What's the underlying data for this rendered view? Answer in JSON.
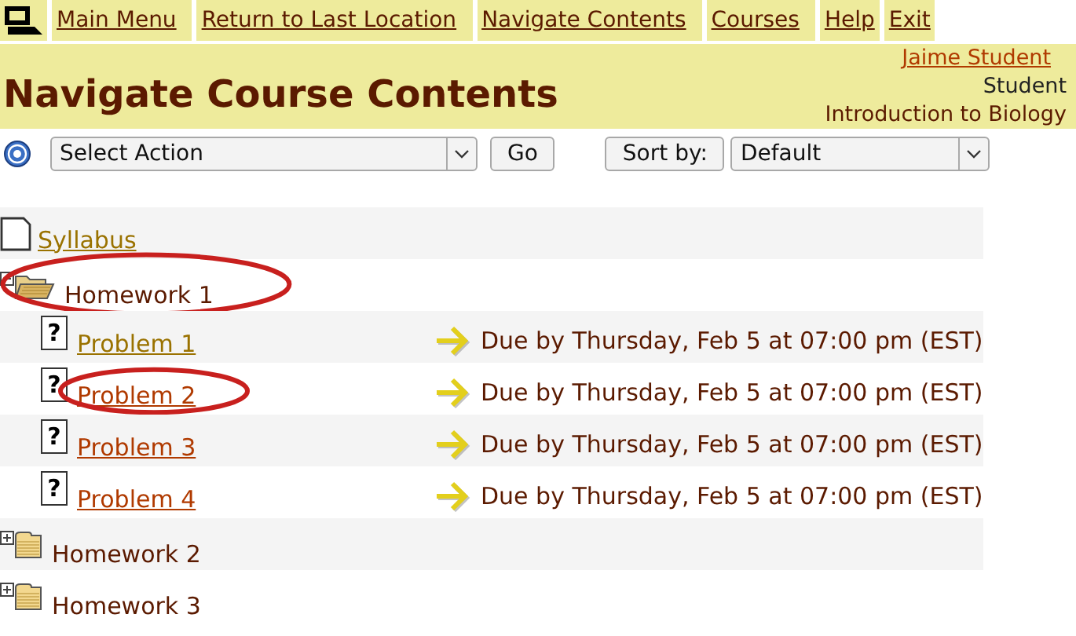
{
  "nav": [
    {
      "label": "Main Menu"
    },
    {
      "label": "Return to Last Location"
    },
    {
      "label": "Navigate Contents"
    },
    {
      "label": "Courses"
    },
    {
      "label": "Help"
    },
    {
      "label": "Exit"
    }
  ],
  "header": {
    "title": "Navigate Course Contents",
    "user": "Jaime Student",
    "role": "Student",
    "course": "Introduction to Biology"
  },
  "toolbar": {
    "action": "Select Action",
    "go": "Go",
    "sort_label": "Sort by:",
    "sort": "Default"
  },
  "contents": [
    {
      "kind": "document",
      "label": "Syllabus",
      "visited": true,
      "highlighted": false
    },
    {
      "kind": "folder",
      "label": "Homework 1",
      "expanded": true,
      "highlighted": true,
      "children": [
        {
          "kind": "problem",
          "icon": "?",
          "label": "Problem 1",
          "visited": true,
          "highlighted": false,
          "due": "Due by Thursday, Feb 5 at 07:00 pm (EST)"
        },
        {
          "kind": "problem",
          "icon": "?",
          "label": "Problem 2",
          "visited": false,
          "highlighted": true,
          "due": "Due by Thursday, Feb 5 at 07:00 pm (EST)"
        },
        {
          "kind": "problem",
          "icon": "?",
          "label": "Problem 3",
          "visited": false,
          "highlighted": false,
          "due": "Due by Thursday, Feb 5 at 07:00 pm (EST)"
        },
        {
          "kind": "problem",
          "icon": "?",
          "label": "Problem 4",
          "visited": false,
          "highlighted": false,
          "due": "Due by Thursday, Feb 5 at 07:00 pm (EST)"
        }
      ]
    },
    {
      "kind": "folder",
      "label": "Homework 2",
      "expanded": false,
      "highlighted": false
    },
    {
      "kind": "folder",
      "label": "Homework 3",
      "expanded": false,
      "highlighted": false
    }
  ]
}
